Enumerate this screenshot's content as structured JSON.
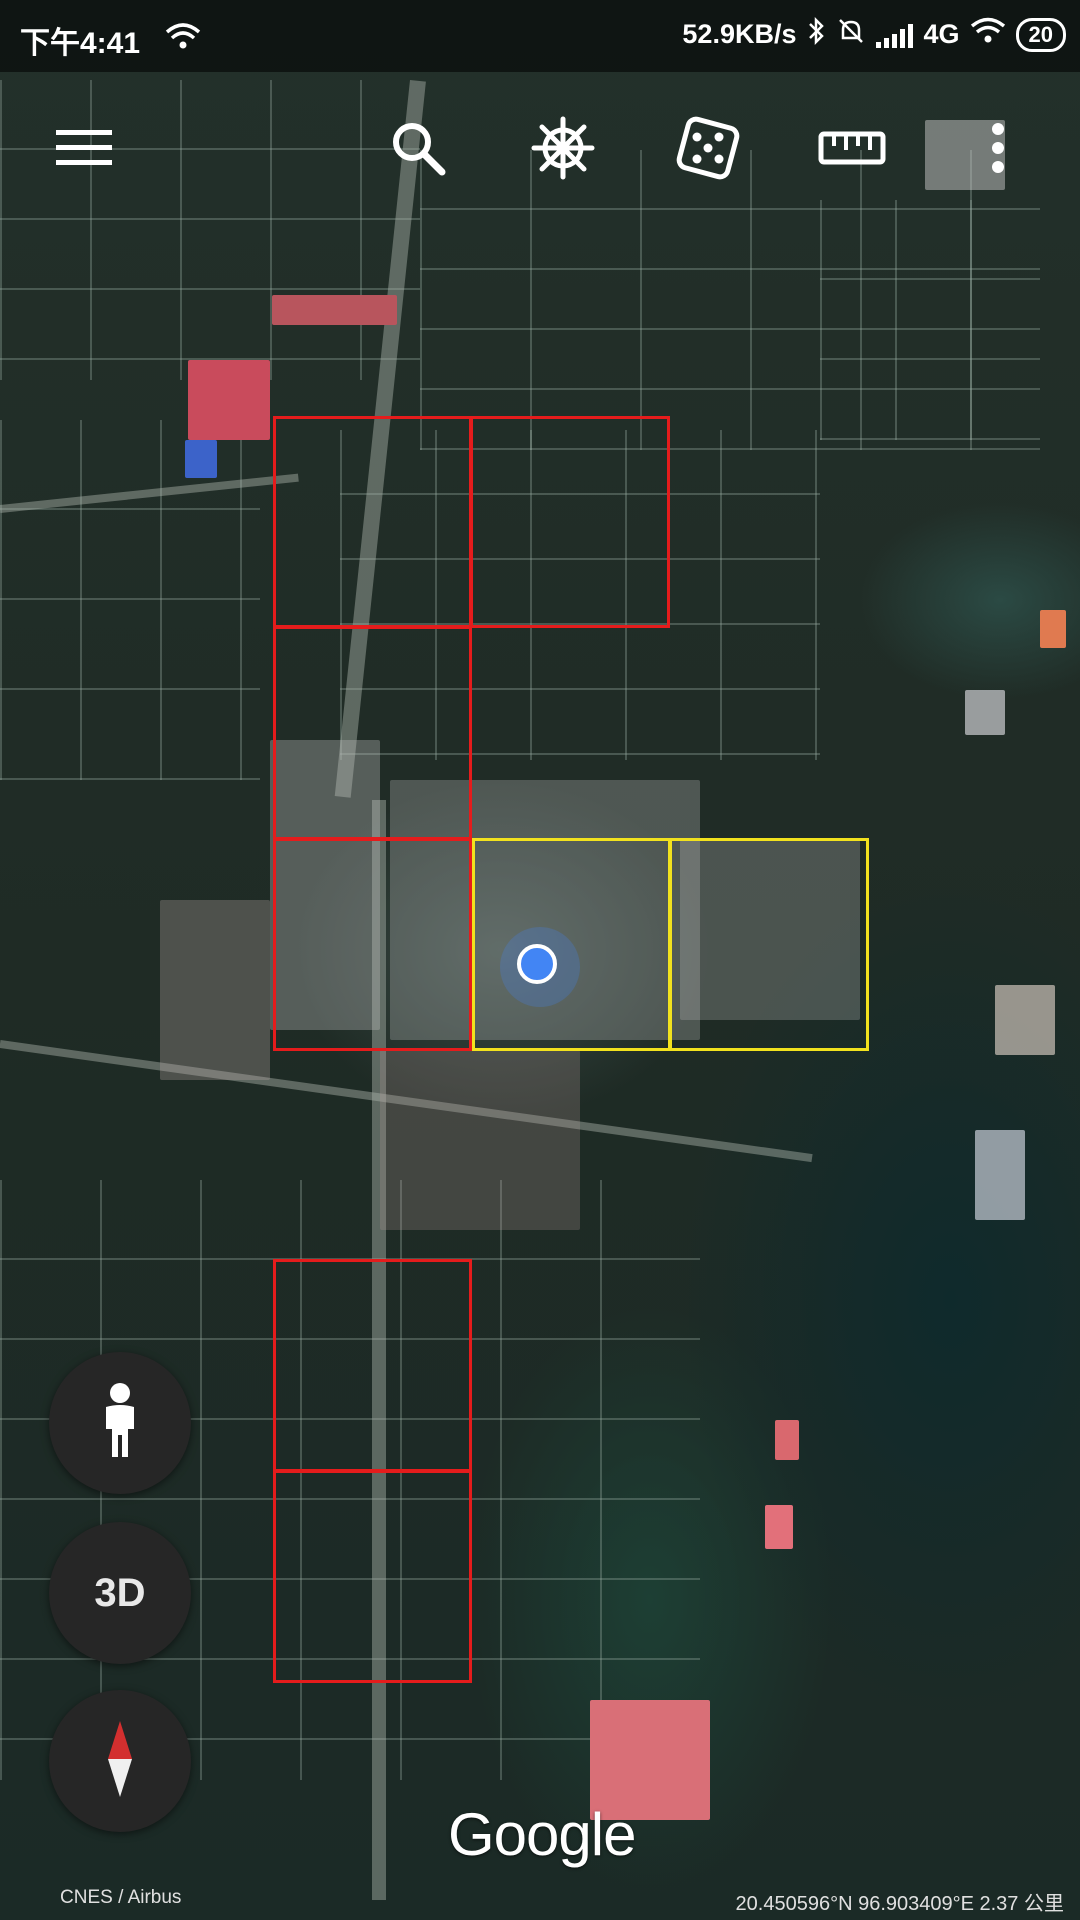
{
  "status_bar": {
    "time": "下午4:41",
    "net_speed": "52.9KB/s",
    "network_type": "4G",
    "battery": "20"
  },
  "toolbar": {
    "menu_icon": "hamburger-menu-icon",
    "search_icon": "search-icon",
    "voyager_icon": "ship-wheel-icon",
    "feeling_lucky_icon": "dice-icon",
    "measure_icon": "ruler-icon",
    "more_icon": "more-vert-icon"
  },
  "left_controls": {
    "street_view_icon": "pegman-icon",
    "three_d_label": "3D",
    "compass_icon": "compass-icon"
  },
  "map": {
    "logo": "Google",
    "attribution": "CNES / Airbus",
    "coordinates": "20.450596°N 96.903409°E 2.37 公里"
  },
  "colors": {
    "red_box": "#e51c1c",
    "yellow_box": "#f2e21e",
    "location_dot": "#4285f4",
    "fab_bg": "#262626"
  }
}
